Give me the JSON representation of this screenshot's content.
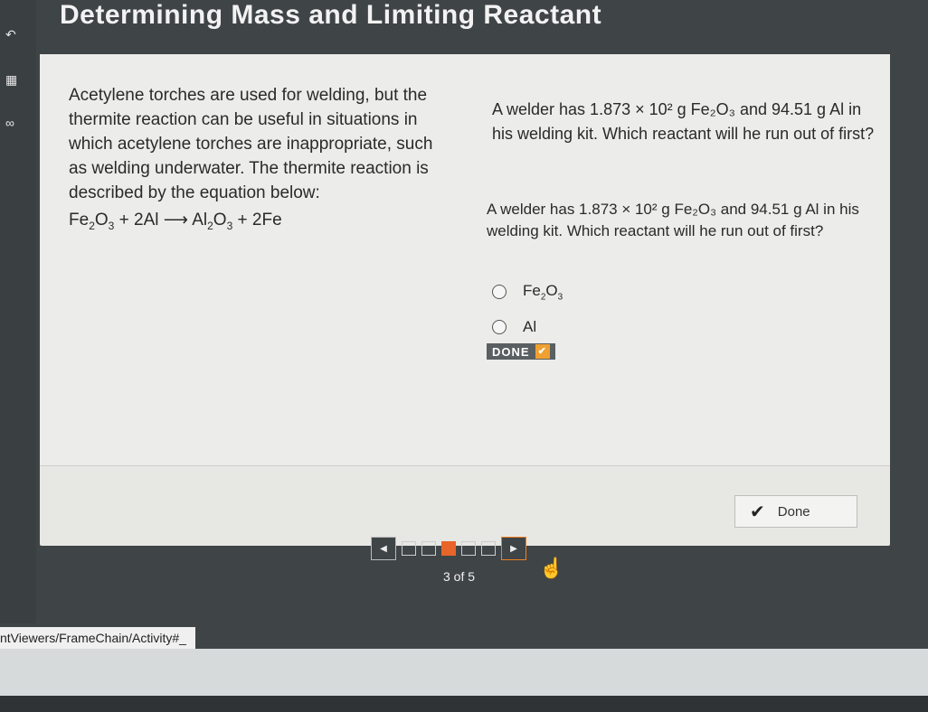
{
  "header": {
    "title": "Determining Mass and Limiting Reactant"
  },
  "lesson": {
    "intro": "Acetylene torches are used for welding, but the thermite reaction can be useful in situations in which acetylene torches are inappropriate, such as welding underwater. The thermite reaction is described by the equation below:"
  },
  "equation": {
    "p1": "Fe",
    "s1": "2",
    "p2": "O",
    "s2": "3",
    "p3": " + 2Al ⟶ Al",
    "s3": "2",
    "p4": "O",
    "s4": "3",
    "p5": " + 2Fe"
  },
  "question": {
    "prompt_main": "A welder has 1.873 × 10² g Fe₂O₃ and 94.51 g Al in his welding kit. Which reactant will he run out of first?",
    "prompt_repeat": "A welder has 1.873 × 10² g Fe₂O₃ and 94.51 g Al in his welding kit. Which reactant will he run out of first?",
    "options": [
      {
        "text": "Fe",
        "sub1": "2",
        "text2": "O",
        "sub2": "3"
      },
      {
        "text": "Al"
      }
    ],
    "done_label": "DONE"
  },
  "footer": {
    "done_button": "Done",
    "page_count": "3 of 5",
    "url_text": "ntViewers/FrameChain/Activity#_"
  },
  "icons": [
    "undo-icon",
    "calculator-icon",
    "link-icon",
    "check-icon",
    "prev-arrow-icon",
    "next-arrow-icon",
    "hand-cursor-icon"
  ],
  "colors": {
    "accent": "#e8652a",
    "badge": "#5a5f61"
  }
}
